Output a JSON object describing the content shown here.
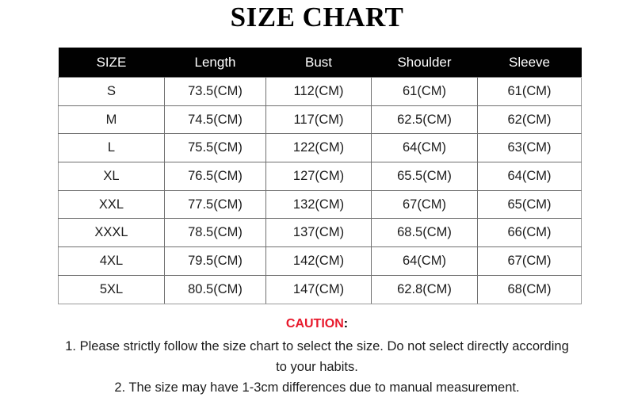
{
  "title": "SIZE CHART",
  "table": {
    "headers": [
      "SIZE",
      "Length",
      "Bust",
      "Shoulder",
      "Sleeve"
    ],
    "rows": [
      {
        "size": "S",
        "length": "73.5(CM)",
        "bust": "112(CM)",
        "shoulder": "61(CM)",
        "sleeve": "61(CM)"
      },
      {
        "size": "M",
        "length": "74.5(CM)",
        "bust": "117(CM)",
        "shoulder": "62.5(CM)",
        "sleeve": "62(CM)"
      },
      {
        "size": "L",
        "length": "75.5(CM)",
        "bust": "122(CM)",
        "shoulder": "64(CM)",
        "sleeve": "63(CM)"
      },
      {
        "size": "XL",
        "length": "76.5(CM)",
        "bust": "127(CM)",
        "shoulder": "65.5(CM)",
        "sleeve": "64(CM)"
      },
      {
        "size": "XXL",
        "length": "77.5(CM)",
        "bust": "132(CM)",
        "shoulder": "67(CM)",
        "sleeve": "65(CM)"
      },
      {
        "size": "XXXL",
        "length": "78.5(CM)",
        "bust": "137(CM)",
        "shoulder": "68.5(CM)",
        "sleeve": "66(CM)"
      },
      {
        "size": "4XL",
        "length": "79.5(CM)",
        "bust": "142(CM)",
        "shoulder": "64(CM)",
        "sleeve": "67(CM)"
      },
      {
        "size": "5XL",
        "length": "80.5(CM)",
        "bust": "147(CM)",
        "shoulder": "62.8(CM)",
        "sleeve": "68(CM)"
      }
    ]
  },
  "caution": {
    "word": "CAUTION",
    "colon": ":",
    "line1": "1. Please strictly follow the size chart to select the size. Do not select directly according",
    "line2": "to your habits.",
    "line3": "2. The size may have 1-3cm differences due to manual measurement."
  },
  "colors": {
    "header_bg": "#010101",
    "header_text": "#ffffff",
    "caution_red": "#e8192c",
    "body_text": "#1c1c1c",
    "grid_line": "#6f6f6f",
    "background": "#ffffff"
  }
}
